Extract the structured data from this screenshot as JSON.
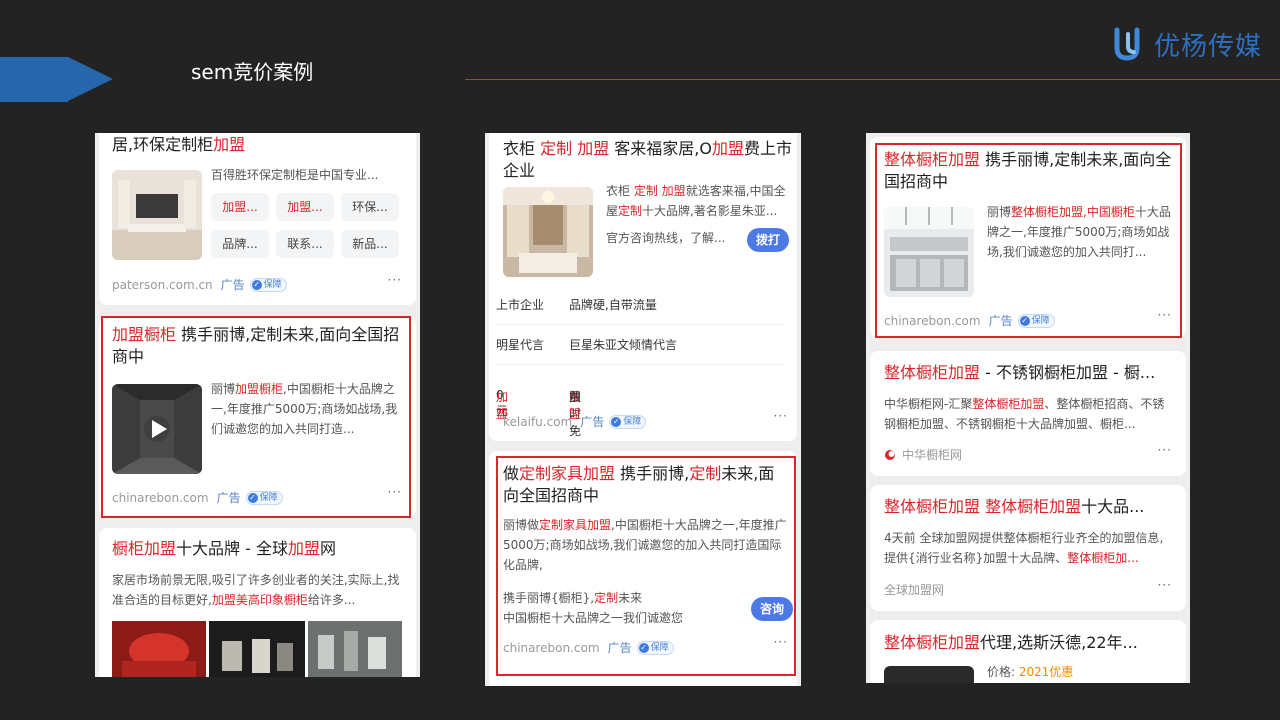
{
  "slide": {
    "title": "sem竞价案例",
    "logo_text": "优杨传媒"
  },
  "colors": {
    "highlight": "#d9262a",
    "accent": "#2566ad",
    "badge": "#3b7be0"
  },
  "common": {
    "ad_label": "广告",
    "badge_label": "保障",
    "badge_icon": "check-shield-icon",
    "more": "···"
  },
  "left": {
    "top_card": {
      "title": "居,环保定制柜",
      "title_hl": "加盟",
      "desc": "百得胜环保定制柜是中国专业...",
      "tags": [
        {
          "t1": "加盟...",
          "hl": true
        },
        {
          "t1": "加盟...",
          "hl": true
        },
        {
          "t1": "环保...",
          "hl": false
        },
        {
          "t1": "品牌...",
          "hl": false
        },
        {
          "t1": "联系...",
          "hl": false
        },
        {
          "t1": "新品...",
          "hl": false
        }
      ],
      "source": "paterson.com.cn"
    },
    "mid_card": {
      "title_hl": "加盟橱柜",
      "title_rest": " 携手丽博,定制未来,面向全国招商中",
      "d1": "丽博",
      "d1_hl": "加盟橱柜",
      "d1_rest": ",中国橱柜十大品牌之一,年度推广5000万;商场如战场,我们诚邀您的加入共同打造...",
      "source": "chinarebon.com"
    },
    "bottom_card": {
      "t_hl1": "橱柜加盟",
      "t_mid": "十大品牌 - 全球",
      "t_hl2": "加盟",
      "t_end": "网",
      "d_pre": "家居市场前景无限,吸引了许多创业者的关注,实际上,找准合适的目标更好,",
      "d_hl": "加盟美高印象橱柜",
      "d_end": "给许多..."
    }
  },
  "middle": {
    "top_card": {
      "t1": "衣柜 ",
      "t_hl1": "定制",
      "t_sp": " ",
      "t_hl2": "加盟",
      "t_mid": " 客来福家居,O",
      "t_hl3": "加盟",
      "t_end": "费上市企业",
      "d_pre": "衣柜 ",
      "d_hl1": "定制",
      "d_sp": " ",
      "d_hl2": "加盟",
      "d_mid": "就选客来福,中国全屋",
      "d_hl3": "定制",
      "d_end": "十大品牌,著名影星朱亚...",
      "hotline": "官方咨询热线，了解...",
      "call_btn": "拨打",
      "rows": [
        {
          "k": "上市企业",
          "v": "品牌硬,自带流量"
        },
        {
          "k": "明星代言",
          "v": "巨星朱亚文倾情代言"
        },
        {
          "k_pre": "0元",
          "k_hl": "加盟",
          "v_pre": "限时免除品牌",
          "v_hl": "加盟",
          "v_end": "费"
        }
      ],
      "source": "kelaifu.com"
    },
    "bottom_card": {
      "t_pre": "做",
      "t_hl": "定制家具加盟",
      "t_mid": " 携手丽博,",
      "t_hl2": "定制",
      "t_end": "未来,面向全国招商中",
      "d_pre": "丽博做",
      "d_hl": "定制家具加盟",
      "d_end": ",中国橱柜十大品牌之一,年度推广5000万;商场如战场,我们诚邀您的加入共同打造国际化品牌,",
      "s1_pre": "携手丽博{橱柜},",
      "s1_hl": "定制",
      "s1_end": "未来",
      "s2": "中国橱柜十大品牌之一我们诚邀您",
      "consult_btn": "咨询",
      "source": "chinarebon.com"
    }
  },
  "right": {
    "card1": {
      "t_hl": "整体橱柜加盟",
      "t_rest": " 携手丽博,定制未来,面向全国招商中",
      "d_pre": "丽博",
      "d_hl": "整体橱柜加盟",
      "d_sep": ",",
      "d_hl2": "中国橱柜",
      "d_end": "十大品牌之一,年度推广5000万;商场如战场,我们诚邀您的加入共同打...",
      "source": "chinarebon.com"
    },
    "card2": {
      "t_hl": "整体橱柜加盟",
      "t_rest": " - 不锈钢橱柜加盟 - 橱...",
      "d_pre": "中华橱柜网-汇聚",
      "d_hl": "整体橱柜加盟",
      "d_end": "、整体橱柜招商、不锈钢橱柜加盟、不锈钢橱柜十大品牌加盟、橱柜...",
      "source": "中华橱柜网"
    },
    "card3": {
      "t_hl": "整体橱柜加盟",
      "t_sp": " ",
      "t_hl2": "整体橱柜加盟",
      "t_end": "十大品...",
      "d_pre": "4天前  全球加盟网提供整体橱柜行业齐全的加盟信息,提供{消行业名称}加盟十大品牌、",
      "d_hl": "整体橱柜加...",
      "source": "全球加盟网"
    },
    "card4": {
      "t_hl": "整体橱柜加盟",
      "t_end": "代理,选斯沃德,22年...",
      "price_label": "价格:",
      "price_value": "2021优惠"
    }
  }
}
